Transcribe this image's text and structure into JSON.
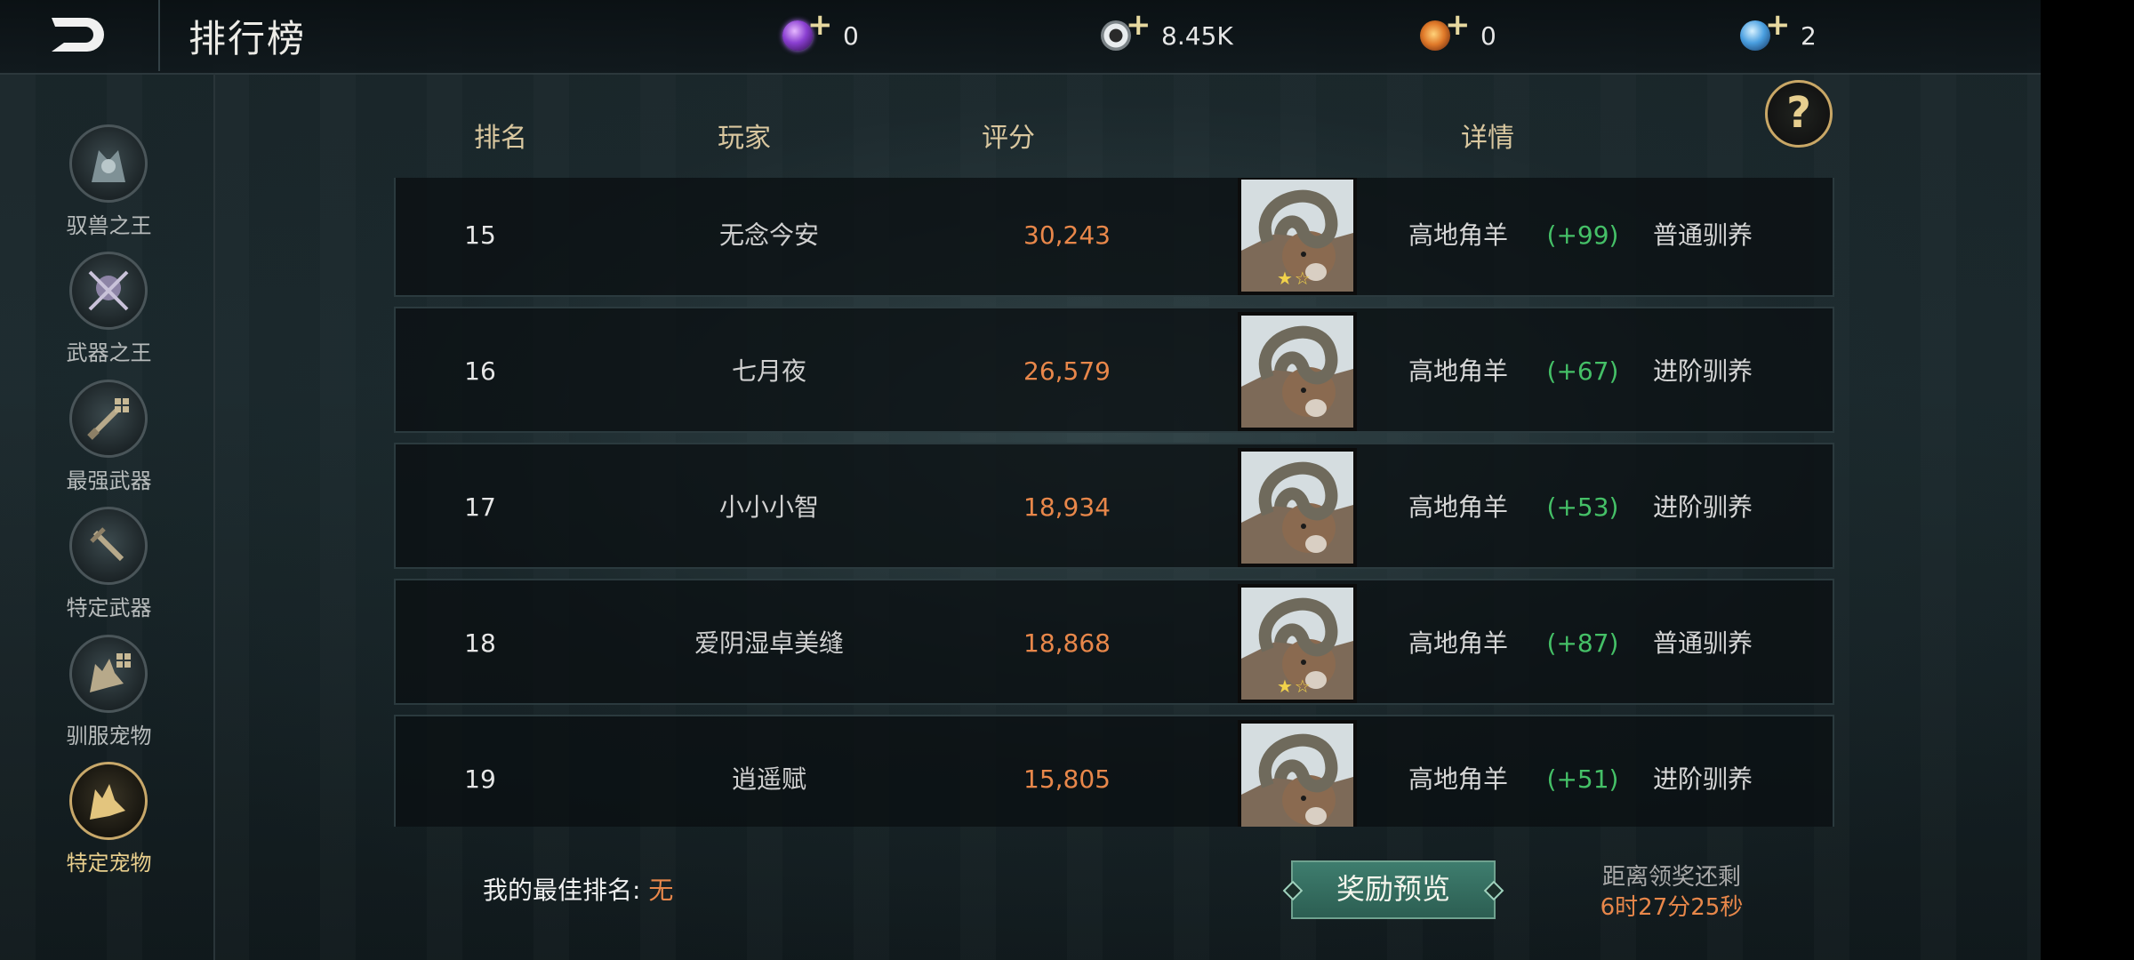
{
  "header": {
    "title": "排行榜",
    "currencies": [
      {
        "icon": "purple-gem-icon",
        "value": "0",
        "color": "#8a3fd1"
      },
      {
        "icon": "silver-coin-icon",
        "value": "8.45K",
        "color": "#bfc6c9"
      },
      {
        "icon": "fire-orb-icon",
        "value": "0",
        "color": "#e07a2a"
      },
      {
        "icon": "blue-crystal-icon",
        "value": "2",
        "color": "#4a9fe0"
      }
    ]
  },
  "sidebar": {
    "items": [
      {
        "label": "驭兽之王",
        "icon": "beast-king-icon"
      },
      {
        "label": "武器之王",
        "icon": "weapon-king-icon"
      },
      {
        "label": "最强武器",
        "icon": "strongest-weapon-icon"
      },
      {
        "label": "特定武器",
        "icon": "specific-weapon-icon"
      },
      {
        "label": "驯服宠物",
        "icon": "tamed-pet-icon"
      },
      {
        "label": "特定宠物",
        "icon": "specific-pet-icon",
        "active": true
      }
    ]
  },
  "table": {
    "headers": {
      "rank": "排名",
      "player": "玩家",
      "score": "评分",
      "details": "详情"
    },
    "rows": [
      {
        "rank": "15",
        "player": "无念今安",
        "score": "30,243",
        "pet": "高地角羊",
        "bonus": "(+99)",
        "tame": "普通驯养",
        "stars": "★☆"
      },
      {
        "rank": "16",
        "player": "七月夜",
        "score": "26,579",
        "pet": "高地角羊",
        "bonus": "(+67)",
        "tame": "进阶驯养",
        "stars": ""
      },
      {
        "rank": "17",
        "player": "小小小智",
        "score": "18,934",
        "pet": "高地角羊",
        "bonus": "(+53)",
        "tame": "进阶驯养",
        "stars": ""
      },
      {
        "rank": "18",
        "player": "爱阴湿卓美缝",
        "score": "18,868",
        "pet": "高地角羊",
        "bonus": "(+87)",
        "tame": "普通驯养",
        "stars": "★☆"
      },
      {
        "rank": "19",
        "player": "逍遥赋",
        "score": "15,805",
        "pet": "高地角羊",
        "bonus": "(+51)",
        "tame": "进阶驯养",
        "stars": ""
      }
    ]
  },
  "footer": {
    "best_rank_label": "我的最佳排名:",
    "best_rank_value": "无",
    "reward_button": "奖励预览",
    "timer_label": "距离领奖还剩",
    "timer_value": "6时27分25秒"
  },
  "help_icon": "?"
}
